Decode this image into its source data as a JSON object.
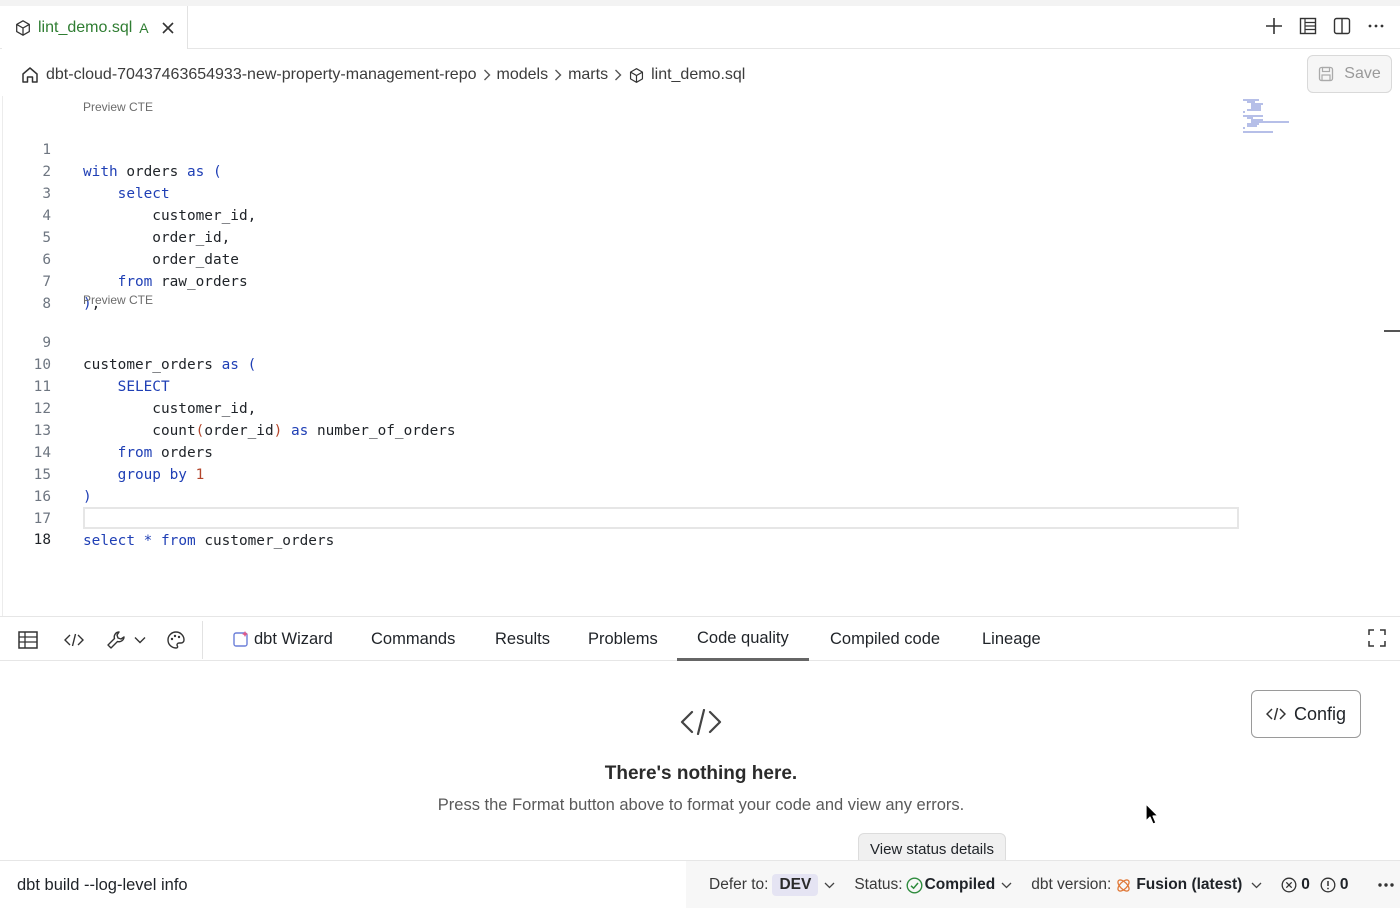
{
  "tab": {
    "file_name": "lint_demo.sql",
    "status": "A",
    "cube_icon": "cube-icon",
    "close_icon": "close-icon"
  },
  "tab_actions": [
    "plus-icon",
    "table-layout-icon",
    "split-editor-icon",
    "more-icon"
  ],
  "breadcrumb": {
    "items": [
      "dbt-cloud-70437463654933-new-property-management-repo",
      "models",
      "marts",
      "lint_demo.sql"
    ]
  },
  "save_button": {
    "label": "Save"
  },
  "editor": {
    "codelens_1": "Preview CTE",
    "codelens_2": "Preview CTE",
    "lines": [
      {
        "n": "1",
        "text": "with orders as ("
      },
      {
        "n": "2",
        "text": "    select"
      },
      {
        "n": "3",
        "text": "        customer_id,"
      },
      {
        "n": "4",
        "text": "        order_id,"
      },
      {
        "n": "5",
        "text": "        order_date"
      },
      {
        "n": "6",
        "text": "    from raw_orders"
      },
      {
        "n": "7",
        "text": "),"
      },
      {
        "n": "8",
        "text": ""
      },
      {
        "n": "9",
        "text": "customer_orders as ("
      },
      {
        "n": "10",
        "text": "    SELECT"
      },
      {
        "n": "11",
        "text": "        customer_id,"
      },
      {
        "n": "12",
        "text": "        count(order_id) as number_of_orders"
      },
      {
        "n": "13",
        "text": "    from orders"
      },
      {
        "n": "14",
        "text": "    group by 1"
      },
      {
        "n": "15",
        "text": ")"
      },
      {
        "n": "16",
        "text": ""
      },
      {
        "n": "17",
        "text": "select * from customer_orders"
      },
      {
        "n": "18",
        "text": ""
      }
    ]
  },
  "panel": {
    "tools": [
      "table-icon",
      "code-icon",
      "wrench-icon",
      "palette-icon"
    ],
    "tabs": [
      "dbt Wizard",
      "Commands",
      "Results",
      "Problems",
      "Code quality",
      "Compiled code",
      "Lineage"
    ],
    "active_tab": "Code quality",
    "empty_title": "There's nothing here.",
    "empty_desc": "Press the Format button above to format your code and view any errors.",
    "config_label": "Config",
    "tooltip": "View status details"
  },
  "statusbar": {
    "command": "dbt build --log-level info",
    "defer_label": "Defer to:",
    "defer_value": "DEV",
    "status_label": "Status:",
    "status_value": "Compiled",
    "version_label": "dbt version:",
    "version_value": "Fusion (latest)",
    "errors": "0",
    "warnings": "0"
  },
  "colors": {
    "keyword": "#1f3fb5",
    "tab_file": "#2f7d32",
    "dev_badge": "#e5e4f3",
    "status_ok": "#2e8b3d"
  }
}
